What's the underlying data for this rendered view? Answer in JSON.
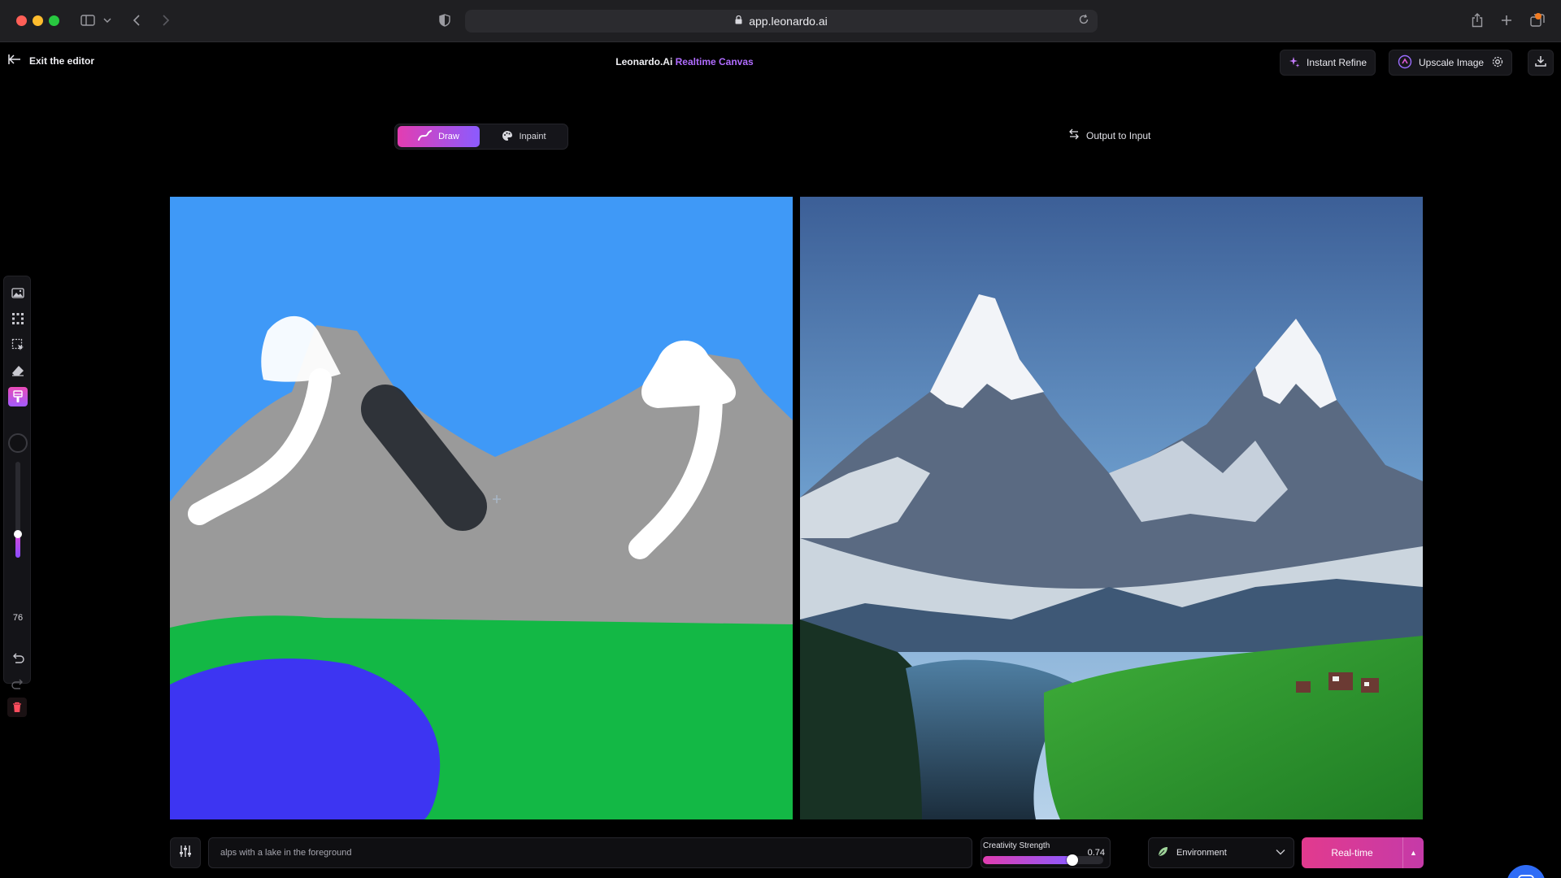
{
  "browser": {
    "url": "app.leonardo.ai",
    "icons": [
      "sidebar-toggle-icon",
      "chevron-down-icon",
      "back-arrow-icon",
      "forward-arrow-icon",
      "shield-icon",
      "lock-icon",
      "reload-icon",
      "share-icon",
      "new-tab-icon",
      "tab-overview-icon"
    ]
  },
  "header": {
    "exit_label": "Exit the editor",
    "title_main": "Leonardo.Ai ",
    "title_accent": "Realtime Canvas",
    "instant_refine": "Instant Refine",
    "upscale_image": "Upscale Image"
  },
  "modes": {
    "draw": "Draw",
    "inpaint": "Inpaint",
    "active": "draw"
  },
  "output_to_input": "Output to Input",
  "toolbar": {
    "tools": [
      "image-upload-icon",
      "grid-select-icon",
      "selection-icon",
      "eraser-icon",
      "brush-icon"
    ],
    "active_tool": "brush-icon",
    "brush_color": "#111114",
    "brush_size": "76",
    "brush_size_fraction": 0.25
  },
  "prompt": {
    "value": "alps with a lake in the foreground"
  },
  "creativity": {
    "label": "Creativity Strength",
    "value": "0.74",
    "fraction": 0.74
  },
  "environment": {
    "selected": "Environment"
  },
  "realtime_button": "Real-time",
  "colors": {
    "accent_pink": "#e33db1",
    "accent_purple": "#8b5bff",
    "title_accent": "#b06cff",
    "sky": "#3f99f7",
    "mountain": "#9a9a9a",
    "grass": "#13b845",
    "lake": "#3d35f2"
  }
}
